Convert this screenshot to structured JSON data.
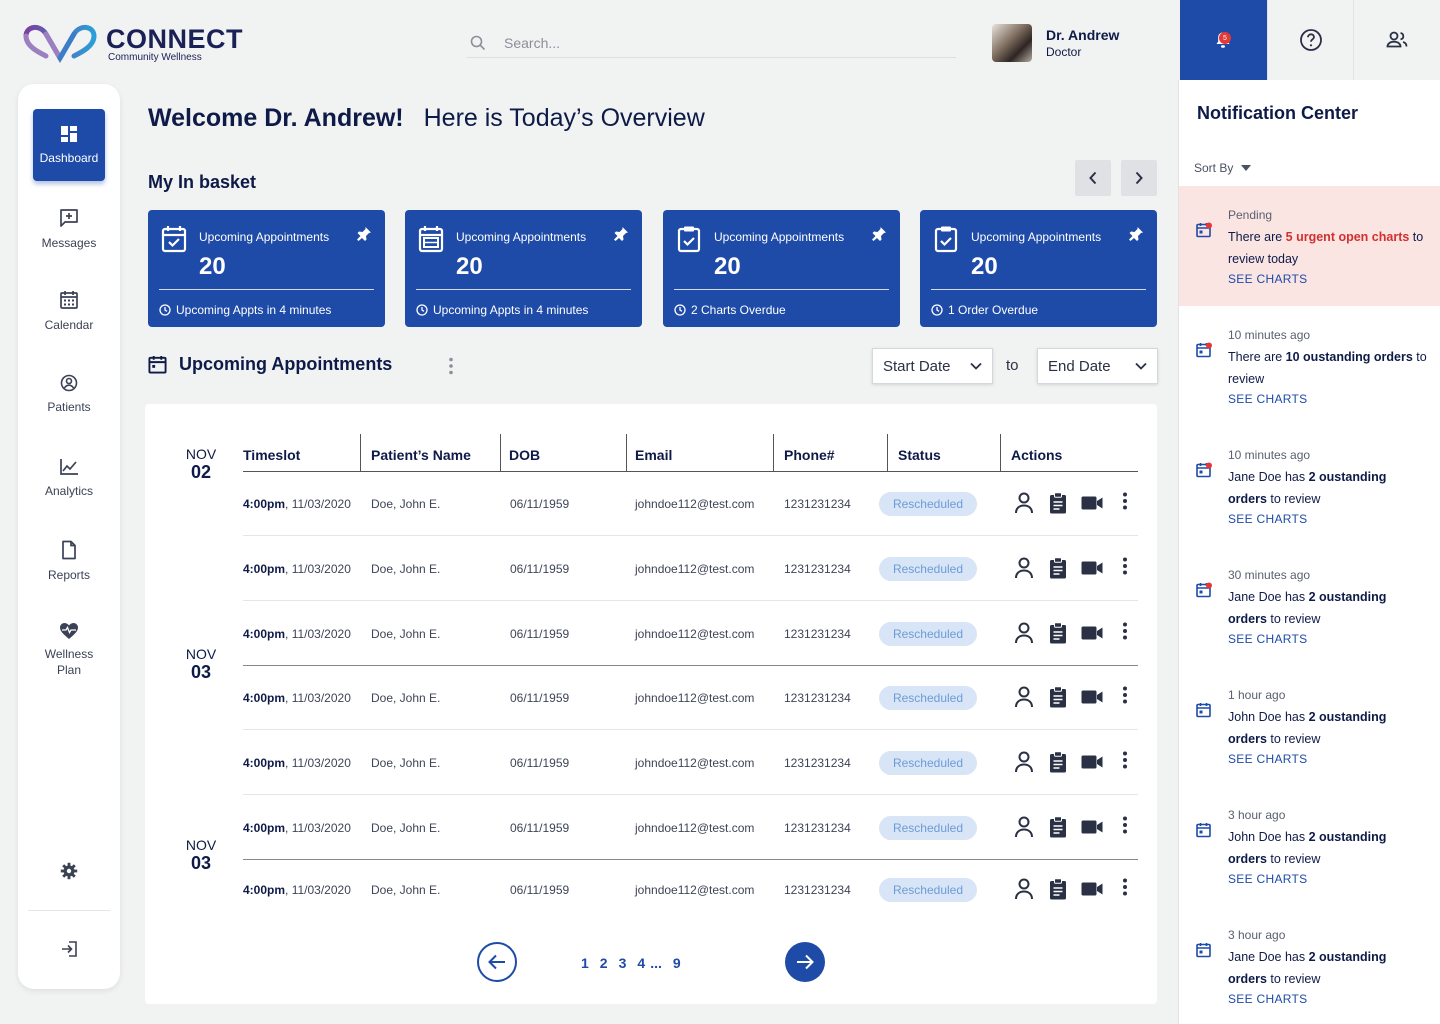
{
  "brand": {
    "name": "CONNECT",
    "tagline": "Community Wellness"
  },
  "search": {
    "placeholder": "Search..."
  },
  "user": {
    "name": "Dr. Andrew",
    "role": "Doctor"
  },
  "notifications_badge": "5",
  "sidebar": {
    "items": [
      {
        "label": "Dashboard",
        "icon": "dashboard-icon",
        "active": true
      },
      {
        "label": "Messages",
        "icon": "message-add-icon"
      },
      {
        "label": "Calendar",
        "icon": "calendar-icon"
      },
      {
        "label": "Patients",
        "icon": "user-circle-icon"
      },
      {
        "label": "Analytics",
        "icon": "analytics-icon"
      },
      {
        "label": "Reports",
        "icon": "report-icon"
      },
      {
        "label": "Wellness Plan",
        "icon": "heart-pulse-icon"
      }
    ]
  },
  "header": {
    "welcome": "Welcome Dr. Andrew!",
    "subtitle": "Here is Today’s Overview"
  },
  "basket": {
    "title": "My In basket",
    "cards": [
      {
        "title": "Upcoming Appointments",
        "value": "20",
        "footer": "Upcoming Appts in 4 minutes"
      },
      {
        "title": "Upcoming Appointments",
        "value": "20",
        "footer": "Upcoming Appts in 4 minutes"
      },
      {
        "title": "Upcoming Appointments",
        "value": "20",
        "footer": "2 Charts Overdue"
      },
      {
        "title": "Upcoming Appointments",
        "value": "20",
        "footer": "1 Order Overdue"
      }
    ]
  },
  "appointments": {
    "title": "Upcoming Appointments",
    "start_date": "Start Date",
    "to": "to",
    "end_date": "End Date",
    "columns": [
      "Timeslot",
      "Patient’s Name",
      "DOB",
      "Email",
      "Phone#",
      "Status",
      "Actions"
    ],
    "date_groups": [
      {
        "month": "NOV",
        "day": "02"
      },
      {
        "month": "NOV",
        "day": "03"
      },
      {
        "month": "NOV",
        "day": "03"
      }
    ],
    "rows": [
      {
        "time": "4:00pm",
        "date": ", 11/03/2020",
        "name": "Doe, John E.",
        "dob": "06/11/1959",
        "email": "johndoe112@test.com",
        "phone": "1231231234",
        "status": "Rescheduled"
      },
      {
        "time": "4:00pm",
        "date": ", 11/03/2020",
        "name": "Doe, John E.",
        "dob": "06/11/1959",
        "email": "johndoe112@test.com",
        "phone": "1231231234",
        "status": "Rescheduled"
      },
      {
        "time": "4:00pm",
        "date": ", 11/03/2020",
        "name": "Doe, John E.",
        "dob": "06/11/1959",
        "email": "johndoe112@test.com",
        "phone": "1231231234",
        "status": "Rescheduled"
      },
      {
        "time": "4:00pm",
        "date": ", 11/03/2020",
        "name": "Doe, John E.",
        "dob": "06/11/1959",
        "email": "johndoe112@test.com",
        "phone": "1231231234",
        "status": "Rescheduled"
      },
      {
        "time": "4:00pm",
        "date": ", 11/03/2020",
        "name": "Doe, John E.",
        "dob": "06/11/1959",
        "email": "johndoe112@test.com",
        "phone": "1231231234",
        "status": "Rescheduled"
      },
      {
        "time": "4:00pm",
        "date": ", 11/03/2020",
        "name": "Doe, John E.",
        "dob": "06/11/1959",
        "email": "johndoe112@test.com",
        "phone": "1231231234",
        "status": "Rescheduled"
      },
      {
        "time": "4:00pm",
        "date": ", 11/03/2020",
        "name": "Doe, John E.",
        "dob": "06/11/1959",
        "email": "johndoe112@test.com",
        "phone": "1231231234",
        "status": "Rescheduled"
      }
    ],
    "pagination": {
      "pages": [
        "1",
        "2",
        "3",
        "4",
        "...",
        "9"
      ]
    }
  },
  "notification_center": {
    "title": "Notification Center",
    "sort_label": "Sort By",
    "link_label": "SEE CHARTS",
    "items": [
      {
        "time": "Pending",
        "pre": "There are ",
        "em": "5 urgent open charts",
        "post": " to review today",
        "urgent": true
      },
      {
        "time": "10 minutes ago",
        "pre": "There are ",
        "em": "10 oustanding orders",
        "post": " to review"
      },
      {
        "time": "10 minutes ago",
        "pre": "Jane Doe has ",
        "em": "2 oustanding orders",
        "post": " to review"
      },
      {
        "time": "30 minutes ago",
        "pre": "Jane Doe has ",
        "em": "2 oustanding orders",
        "post": " to review"
      },
      {
        "time": "1 hour ago",
        "pre": "John Doe has ",
        "em": "2 oustanding orders",
        "post": " to review"
      },
      {
        "time": "3 hour ago",
        "pre": "John Doe has ",
        "em": "2 oustanding orders",
        "post": " to review"
      },
      {
        "time": "3 hour ago",
        "pre": "Jane Doe has ",
        "em": "2 oustanding orders",
        "post": " to review"
      }
    ]
  },
  "colors": {
    "primary": "#1e4aa8",
    "navy": "#0e1a47",
    "urgent_bg": "#fae5e3",
    "urgent_text": "#d32f2f",
    "status_bg": "#d7e5f7"
  }
}
